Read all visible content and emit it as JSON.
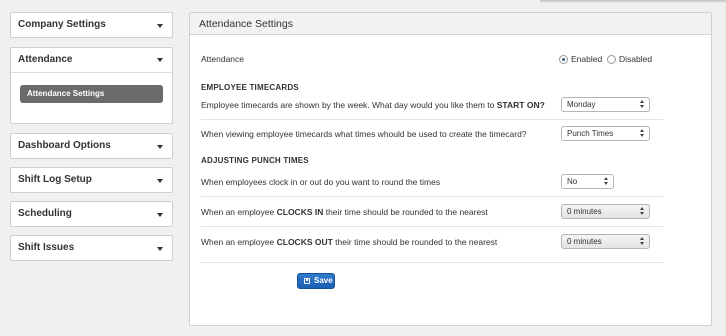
{
  "sidebar": {
    "items": [
      {
        "label": "Company Settings"
      },
      {
        "label": "Attendance",
        "subitems": [
          {
            "label": "Attendance Settings",
            "active": true
          }
        ]
      },
      {
        "label": "Dashboard Options"
      },
      {
        "label": "Shift Log Setup"
      },
      {
        "label": "Scheduling"
      },
      {
        "label": "Shift Issues"
      }
    ]
  },
  "panel": {
    "title": "Attendance Settings",
    "attendance": {
      "label": "Attendance",
      "options": [
        {
          "label": "Enabled",
          "selected": true
        },
        {
          "label": "Disabled",
          "selected": false
        }
      ]
    },
    "timecards": {
      "heading": "EMPLOYEE TIMECARDS",
      "start_label": "Employee timecards are shown by the week. What day would you like them to ",
      "start_label_bold": "START ON?",
      "start_value": "Monday",
      "times_label": "When viewing employee timecards what times whould be used to create the timecard?",
      "times_value": "Punch Times"
    },
    "punch": {
      "heading": "ADJUSTING PUNCH TIMES",
      "round_label": "When employees clock in or out do you want to round the times",
      "round_value": "No",
      "in_label_pre": "When an employee ",
      "in_label_bold": "CLOCKS IN",
      "in_label_post": " their time should be rounded to the nearest",
      "in_value": "0 minutes",
      "out_label_pre": "When an employee ",
      "out_label_bold": "CLOCKS OUT",
      "out_label_post": " their time should be rounded to the nearest",
      "out_value": "0 minutes"
    },
    "save_label": "Save"
  }
}
